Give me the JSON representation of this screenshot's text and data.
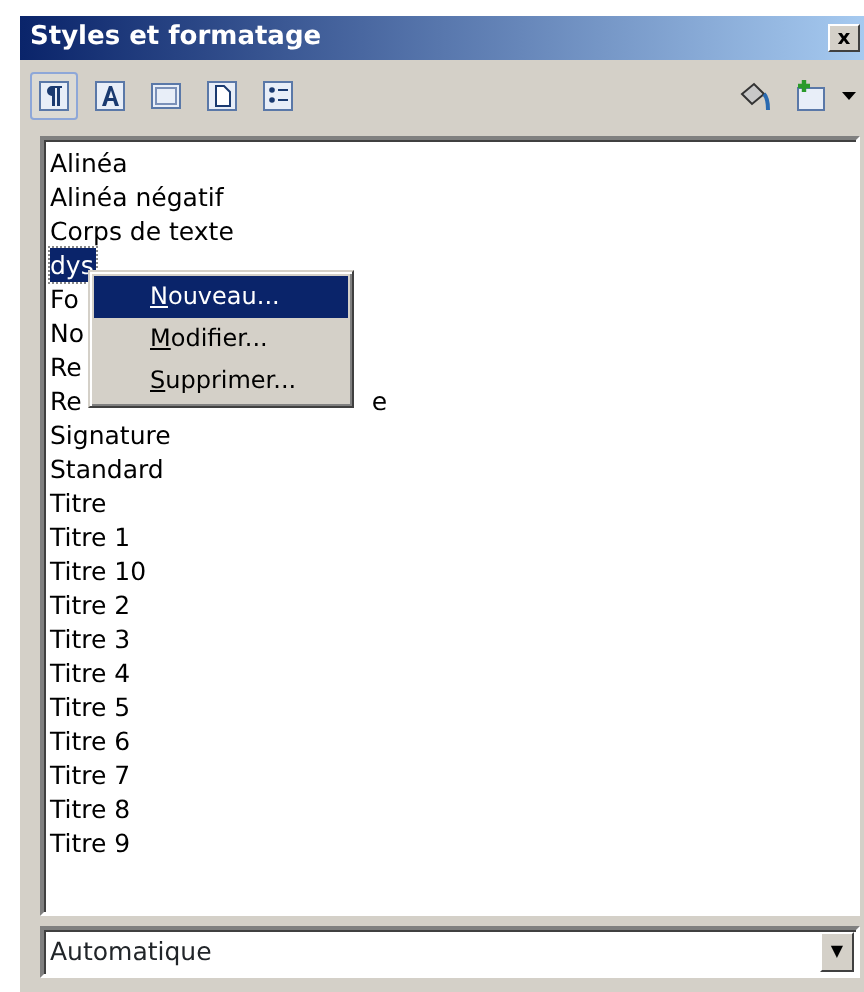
{
  "window": {
    "title": "Styles et formatage",
    "close": "x"
  },
  "toolbar": {
    "family_buttons": [
      {
        "selected": true
      },
      {
        "selected": false
      },
      {
        "selected": false
      },
      {
        "selected": false
      },
      {
        "selected": false
      }
    ]
  },
  "styles": [
    {
      "text": "Alinéa",
      "selected": false
    },
    {
      "text": "Alinéa négatif",
      "selected": false
    },
    {
      "text": "Corps de texte",
      "selected": false
    },
    {
      "text": "dys",
      "selected": true
    },
    {
      "text": "Fo",
      "selected": false
    },
    {
      "text": "No",
      "selected": false
    },
    {
      "text": "Re",
      "selected": false
    },
    {
      "text": "Re",
      "tail": "e",
      "selected": false
    },
    {
      "text": "Signature",
      "selected": false
    },
    {
      "text": "Standard",
      "selected": false
    },
    {
      "text": "Titre",
      "selected": false
    },
    {
      "text": "Titre 1",
      "selected": false
    },
    {
      "text": "Titre 10",
      "selected": false
    },
    {
      "text": "Titre 2",
      "selected": false
    },
    {
      "text": "Titre 3",
      "selected": false
    },
    {
      "text": "Titre 4",
      "selected": false
    },
    {
      "text": "Titre 5",
      "selected": false
    },
    {
      "text": "Titre 6",
      "selected": false
    },
    {
      "text": "Titre 7",
      "selected": false
    },
    {
      "text": "Titre 8",
      "selected": false
    },
    {
      "text": "Titre 9",
      "selected": false
    }
  ],
  "context_menu": [
    {
      "label": "Nouveau...",
      "selected": true
    },
    {
      "label": "Modifier...",
      "selected": false
    },
    {
      "label": "Supprimer...",
      "selected": false
    }
  ],
  "filter": {
    "value": "Automatique",
    "arrow": "▼"
  }
}
